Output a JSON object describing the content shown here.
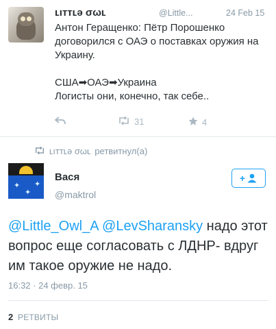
{
  "original_tweet": {
    "author_name": "ʟıттʟə σωʟ",
    "author_handle": "@Little...",
    "date": "24 Feb 15",
    "text_lines": [
      "Антон Геращенко: Пётр Порошенко договорился с ОАЭ о поставках оружия на Украину.",
      "США➡ОАЭ➡Украина",
      "Логисты они, конечно, так себе.."
    ],
    "retweets": "31",
    "favorites": "4"
  },
  "retweet_notice": {
    "retweeter": "ʟıттʟə σωʟ",
    "suffix": "ретвитнул(а)"
  },
  "reply_tweet": {
    "author_name": "Вася",
    "author_handle": "@maktrol",
    "mentions": [
      "@Little_Owl_A",
      "@LevSharansky"
    ],
    "text": "надо этот вопрос еще согласовать с ЛДНР- вдруг им такое оружие не надо.",
    "timestamp": "16:32 · 24 февр. 15",
    "follow_label": "+",
    "retweet_count": "2",
    "retweet_count_label": "РЕТВИТЫ"
  },
  "colors": {
    "accent": "#1da1f2",
    "muted": "#8899a6",
    "text": "#292f33"
  },
  "icons": [
    "reply-icon",
    "retweet-icon",
    "star-icon",
    "follow-user-icon"
  ]
}
